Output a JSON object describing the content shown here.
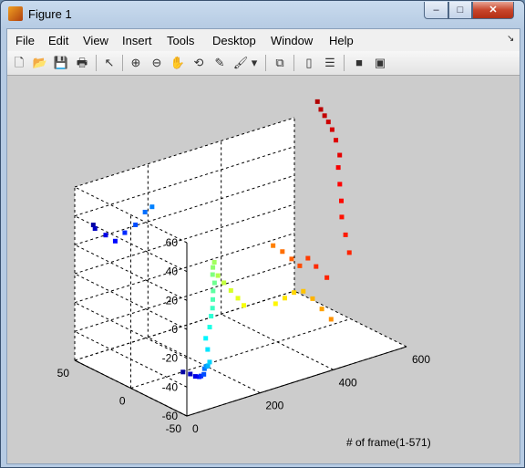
{
  "window": {
    "title": "Figure 1",
    "min_glyph": "–",
    "max_glyph": "□",
    "close_glyph": "✕"
  },
  "menu": [
    "File",
    "Edit",
    "View",
    "Insert",
    "Tools",
    "Desktop",
    "Window",
    "Help"
  ],
  "menu_arrow_glyph": "↘",
  "toolbar": [
    {
      "name": "new-figure-icon",
      "glyph": "🗋"
    },
    {
      "name": "open-file-icon",
      "glyph": "📂"
    },
    {
      "name": "save-icon",
      "glyph": "💾"
    },
    {
      "name": "print-icon",
      "glyph": "🖶"
    },
    {
      "name": "edit-plot-arrow-icon",
      "glyph": "↖"
    },
    {
      "name": "zoom-in-icon",
      "glyph": "⊕"
    },
    {
      "name": "zoom-out-icon",
      "glyph": "⊖"
    },
    {
      "name": "pan-hand-icon",
      "glyph": "✋"
    },
    {
      "name": "rotate-3d-icon",
      "glyph": "⟲"
    },
    {
      "name": "data-cursor-icon",
      "glyph": "✎"
    },
    {
      "name": "brush-icon",
      "glyph": "🖌"
    },
    {
      "name": "brush-dropdown-icon",
      "glyph": "▾"
    },
    {
      "name": "link-plot-icon",
      "glyph": "⧉"
    },
    {
      "name": "colorbar-icon",
      "glyph": "▯"
    },
    {
      "name": "legend-icon",
      "glyph": "☰"
    },
    {
      "name": "hide-plot-tools-icon",
      "glyph": "■"
    },
    {
      "name": "show-plot-tools-icon",
      "glyph": "▣"
    }
  ],
  "chart_data": {
    "type": "scatter",
    "dimensions": 3,
    "xlabel": "# of frame(1-571)",
    "ylabel": "",
    "zlabel": "",
    "xlim": [
      0,
      600
    ],
    "ylim": [
      -50,
      50
    ],
    "zlim": [
      -60,
      60
    ],
    "x_ticks": [
      "0",
      "200",
      "400",
      "600"
    ],
    "y_ticks": [
      "-50",
      "0",
      "50"
    ],
    "z_ticks": [
      "-60",
      "-40",
      "-20",
      "0",
      "20",
      "40",
      "60"
    ],
    "grid": true,
    "colormap": "jet (color encodes frame index)",
    "points": [
      [
        20,
        40,
        36
      ],
      [
        40,
        45,
        30
      ],
      [
        60,
        42,
        25
      ],
      [
        80,
        40,
        20
      ],
      [
        100,
        38,
        25
      ],
      [
        120,
        35,
        30
      ],
      [
        140,
        33,
        38
      ],
      [
        150,
        30,
        42
      ],
      [
        20,
        -40,
        -35
      ],
      [
        40,
        -40,
        -38
      ],
      [
        60,
        -38,
        -42
      ],
      [
        80,
        -35,
        -45
      ],
      [
        100,
        -30,
        -48
      ],
      [
        120,
        -26,
        -50
      ],
      [
        140,
        -20,
        -50
      ],
      [
        160,
        -15,
        -52
      ],
      [
        180,
        -10,
        -55
      ],
      [
        200,
        -5,
        -56
      ],
      [
        210,
        0,
        -50
      ],
      [
        220,
        5,
        -45
      ],
      [
        240,
        8,
        -40
      ],
      [
        250,
        10,
        -34
      ],
      [
        260,
        12,
        -30
      ],
      [
        270,
        15,
        -26
      ],
      [
        280,
        18,
        -22
      ],
      [
        290,
        20,
        -18
      ],
      [
        300,
        25,
        -15
      ],
      [
        310,
        28,
        -12
      ],
      [
        320,
        30,
        -10
      ],
      [
        330,
        30,
        -20
      ],
      [
        340,
        28,
        -25
      ],
      [
        350,
        25,
        -30
      ],
      [
        360,
        22,
        -35
      ],
      [
        370,
        20,
        -40
      ],
      [
        380,
        -5,
        -30
      ],
      [
        390,
        -10,
        -25
      ],
      [
        400,
        -15,
        -20
      ],
      [
        410,
        -20,
        -18
      ],
      [
        420,
        -25,
        -22
      ],
      [
        430,
        -30,
        -28
      ],
      [
        440,
        -35,
        -34
      ],
      [
        450,
        20,
        -5
      ],
      [
        460,
        15,
        -8
      ],
      [
        470,
        10,
        -12
      ],
      [
        480,
        6,
        -16
      ],
      [
        490,
        2,
        -10
      ],
      [
        500,
        -2,
        -15
      ],
      [
        505,
        -10,
        -20
      ],
      [
        505,
        -30,
        5
      ],
      [
        510,
        -25,
        15
      ],
      [
        515,
        -20,
        25
      ],
      [
        520,
        -18,
        35
      ],
      [
        525,
        -15,
        45
      ],
      [
        530,
        -12,
        55
      ],
      [
        540,
        -10,
        62
      ],
      [
        545,
        -5,
        70
      ],
      [
        550,
        0,
        75
      ],
      [
        555,
        5,
        78
      ],
      [
        560,
        10,
        80
      ],
      [
        565,
        15,
        82
      ],
      [
        571,
        20,
        85
      ]
    ]
  }
}
